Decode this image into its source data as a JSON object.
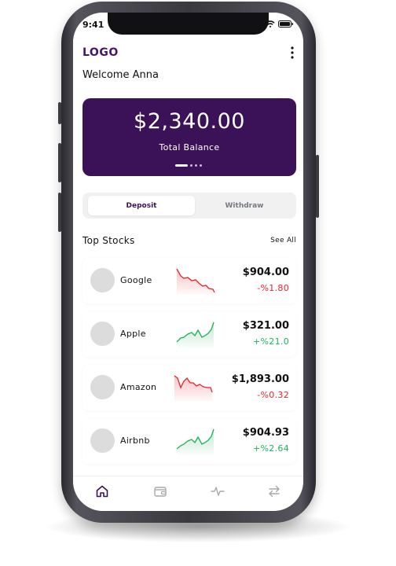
{
  "status_bar": {
    "time": "9:41"
  },
  "header": {
    "logo": "LOGO",
    "welcome": "Welcome Anna"
  },
  "balance": {
    "amount": "$2,340.00",
    "label": "Total Balance",
    "page_count": 4,
    "active_page": 1
  },
  "actions": {
    "deposit_label": "Deposit",
    "withdraw_label": "Withdraw",
    "selected": "Deposit"
  },
  "stocks_section": {
    "title": "Top Stocks",
    "see_all": "See All"
  },
  "stocks": [
    {
      "name": "Google",
      "price": "$904.00",
      "change": "-%1.80",
      "trend": "down"
    },
    {
      "name": "Apple",
      "price": "$321.00",
      "change": "+%21.0",
      "trend": "up"
    },
    {
      "name": "Amazon",
      "price": "$1,893.00",
      "change": "-%0.32",
      "trend": "down"
    },
    {
      "name": "Airbnb",
      "price": "$904.93",
      "change": "+%2.64",
      "trend": "up"
    }
  ],
  "tabbar": {
    "icons": [
      "home-icon",
      "wallet-icon",
      "activity-icon",
      "transfer-icon"
    ],
    "active": "home-icon"
  },
  "colors": {
    "brand": "#3b1158",
    "negative": "#e5242a",
    "positive": "#1fb05a"
  }
}
